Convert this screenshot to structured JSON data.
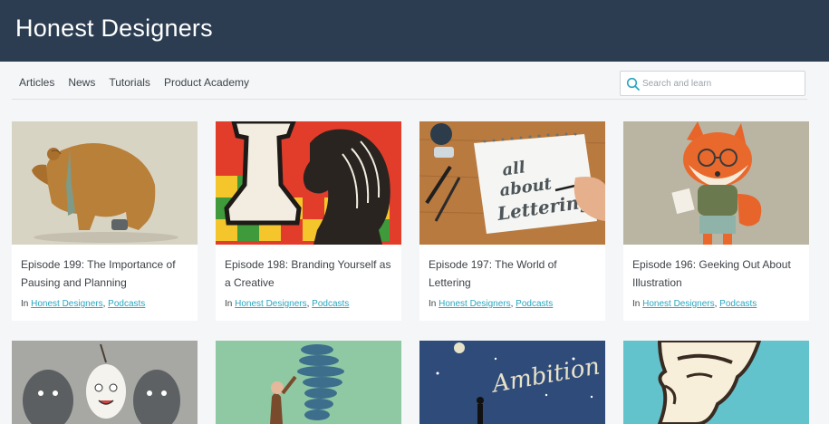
{
  "header": {
    "title": "Honest Designers"
  },
  "nav": {
    "links": [
      "Articles",
      "News",
      "Tutorials",
      "Product Academy"
    ]
  },
  "search": {
    "placeholder": "Search and learn",
    "icon": "search-icon"
  },
  "cards": [
    {
      "title": "Episode 199: The Importance of Pausing and Planning",
      "prefix": "In",
      "categories": [
        "Honest Designers",
        "Podcasts"
      ],
      "separator": ",",
      "image": "bear illustration"
    },
    {
      "title": "Episode 198: Branding Yourself as a Creative",
      "prefix": "In",
      "categories": [
        "Honest Designers",
        "Podcasts"
      ],
      "separator": ",",
      "image": "chess pieces illustration"
    },
    {
      "title": "Episode 197: The World of Lettering",
      "prefix": "In",
      "categories": [
        "Honest Designers",
        "Podcasts"
      ],
      "separator": ",",
      "image": "hand lettering photo"
    },
    {
      "title": "Episode 196: Geeking Out About Illustration",
      "prefix": "In",
      "categories": [
        "Honest Designers",
        "Podcasts"
      ],
      "separator": ",",
      "image": "fox illustration"
    }
  ],
  "second_row": {
    "thumb_3_text": "Ambition"
  },
  "lettering_text": {
    "line1": "all",
    "line2": "about",
    "line3": "Lettering"
  },
  "colors": {
    "header_bg": "#2c3d52",
    "link": "#2aa6c0",
    "page_bg": "#f4f6f8"
  }
}
